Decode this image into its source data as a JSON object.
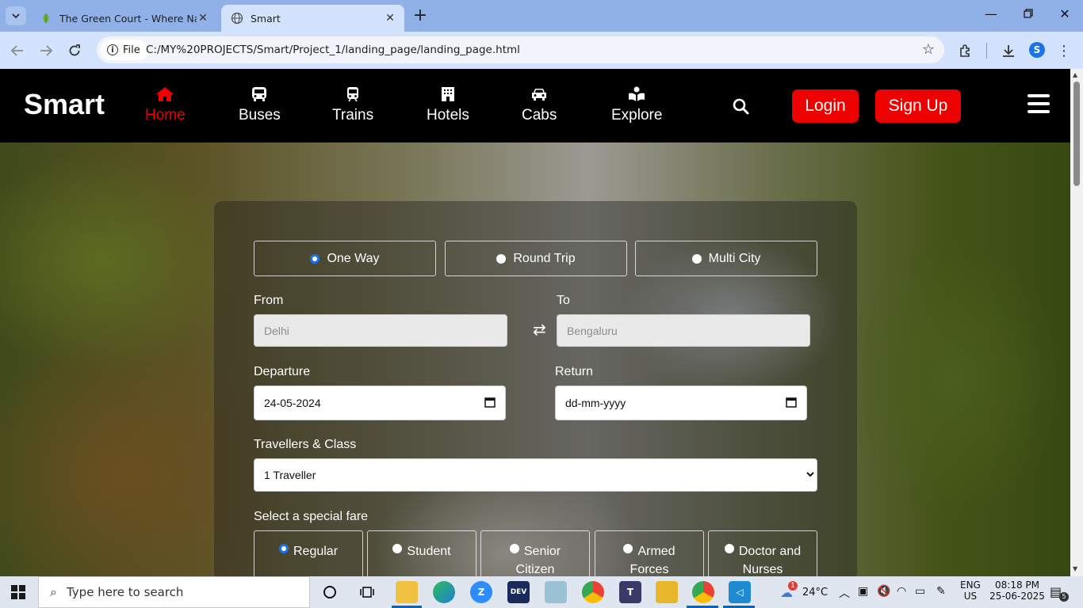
{
  "browser": {
    "tabs": [
      {
        "title": "The Green Court - Where Natur",
        "active": false
      },
      {
        "title": "Smart",
        "active": true
      }
    ],
    "new_tab_label": "+",
    "omnibox": {
      "chip_label": "File",
      "url": "C:/MY%20PROJECTS/Smart/Project_1/landing_page/landing_page.html"
    },
    "profile_initial": "S"
  },
  "site": {
    "logo": "Smart",
    "nav": [
      {
        "label": "Home",
        "icon": "home-icon",
        "active": true
      },
      {
        "label": "Buses",
        "icon": "bus-icon",
        "active": false
      },
      {
        "label": "Trains",
        "icon": "train-icon",
        "active": false
      },
      {
        "label": "Hotels",
        "icon": "hotel-icon",
        "active": false
      },
      {
        "label": "Cabs",
        "icon": "car-icon",
        "active": false
      },
      {
        "label": "Explore",
        "icon": "explore-icon",
        "active": false
      }
    ],
    "login_label": "Login",
    "signup_label": "Sign Up",
    "accent_color": "#ee0000"
  },
  "booking": {
    "trip_types": [
      {
        "label": "One Way",
        "checked": true
      },
      {
        "label": "Round Trip",
        "checked": false
      },
      {
        "label": "Multi City",
        "checked": false
      }
    ],
    "from_label": "From",
    "from_placeholder": "Delhi",
    "to_label": "To",
    "to_placeholder": "Bengaluru",
    "departure_label": "Departure",
    "departure_value": "24-05-2024",
    "return_label": "Return",
    "return_value": "dd-mm-yyyy",
    "travellers_label": "Travellers & Class",
    "travellers_value": "1 Traveller",
    "fare_label": "Select a special fare",
    "fares": [
      {
        "label": "Regular",
        "checked": true
      },
      {
        "label": "Student",
        "checked": false
      },
      {
        "label": "Senior Citizen",
        "line1": "Senior",
        "line2": "Citizen",
        "checked": false
      },
      {
        "label": "Armed Forces",
        "line1": "Armed",
        "line2": "Forces",
        "checked": false
      },
      {
        "label": "Doctor and Nurses",
        "line1": "Doctor and",
        "line2": "Nurses",
        "checked": false
      }
    ]
  },
  "taskbar": {
    "search_placeholder": "Type here to search",
    "weather": "24°C",
    "weather_badge": "1",
    "language": "ENG",
    "region": "US",
    "time": "08:18 PM",
    "date": "25-06-2025",
    "notification_count": "5",
    "app_label_dev": "DEV"
  }
}
